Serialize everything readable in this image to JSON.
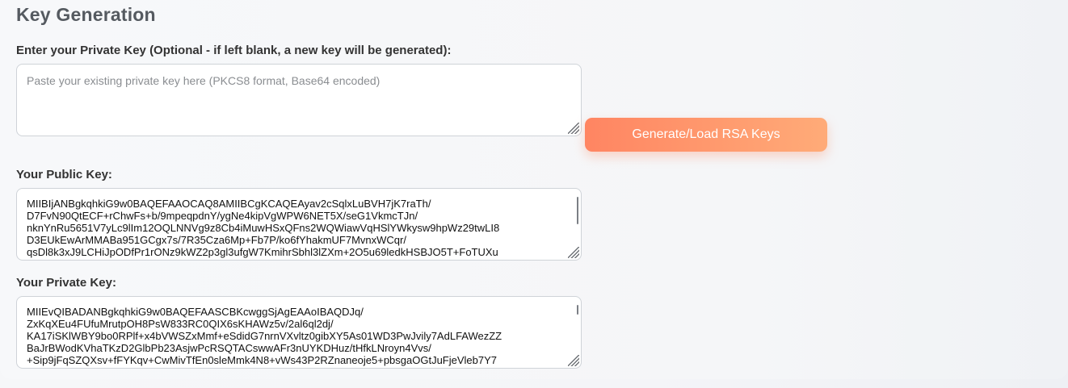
{
  "page": {
    "title": "Key Generation"
  },
  "private_key_input": {
    "label": "Enter your Private Key (Optional - if left blank, a new key will be generated):",
    "placeholder": "Paste your existing private key here (PKCS8 format, Base64 encoded)",
    "value": ""
  },
  "generate_button": {
    "label": "Generate/Load RSA Keys"
  },
  "public_key": {
    "label": "Your Public Key:",
    "value": "MIIBIjANBgkqhkiG9w0BAQEFAAOCAQ8AMIIBCgKCAQEAyav2cSqlxLuBVH7jK7raTh/\nD7FvN90QtECF+rChwFs+b/9mpeqpdnY/ygNe4kipVgWPW6NET5X/seG1VkmcTJn/\nnknYnRu5651V7yLc9lIm12OQLNNVg9z8Cb4iMuwHSxQFns2WQWiawVqHSlYWkysw9hpWz29twLI8\nD3EUkEwArMMABa951GCgx7s/7R35Cza6Mp+Fb7P/ko6fYhakmUF7MvnxWCqr/\nqsDl8k3xJ9LCHiJpODfPr1rONz9kWZ2p3gl3ufgW7KmihrSbhl3lZXm+2O5u69ledkHSBJO5T+FoTUXu"
  },
  "private_key": {
    "label": "Your Private Key:",
    "value": "MIIEvQIBADANBgkqhkiG9w0BAQEFAASCBKcwggSjAgEAAoIBAQDJq/\nZxKqXEu4FUfuMrutpOH8PsW833RC0QIX6sKHAWz5v/2al6ql2dj/\nKA17iSKlWBY9bo0RPlf+x4bVWSZxMmf+eSdidG7nrnVXvltz0gibXY5As01WD3PwJvily7AdLFAWezZZ\nBaJrBWodKVhaTKzD2GlbPb23AsjwPcRSQTACswwAFr3nUYKDHuz/tHfkLNroyn4Vvs/\n+Sip9jFqSZQXsv+fFYKqv+CwMivTfEn0sleMmk4N8+vWs43P2RZnaneoje5+pbsgaOGtJuFjeVleb7Y7"
  }
}
